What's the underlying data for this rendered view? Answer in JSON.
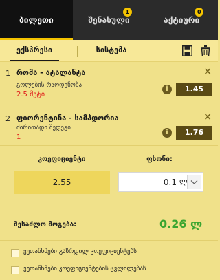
{
  "tabs": [
    {
      "label": "ბილეთი"
    },
    {
      "label": "შენახული",
      "count": "1"
    },
    {
      "label": "აქტიური",
      "count": "0"
    }
  ],
  "subtabs": [
    {
      "label": "ექსპრესი"
    },
    {
      "label": "სისტემა"
    }
  ],
  "icons": {
    "save": "save-icon",
    "trash": "trash-icon",
    "info": "info-icon",
    "close": "close-icon",
    "dropdown": "chevron-down-icon"
  },
  "bets": [
    {
      "number": "1",
      "match": "რომა - ატალანტა",
      "market": "გოლების რაოდენობა",
      "selection": "2.5 მეტი",
      "odds": "1.45",
      "info": "i",
      "close": "×"
    },
    {
      "number": "2",
      "match": "ფიორენტინა - სამპდორია",
      "market": "ძირითადი შედეგი",
      "selection": "1",
      "odds": "1.76",
      "info": "i",
      "close": "×"
    }
  ],
  "coefficient": {
    "label": "კოეფიციენტი",
    "value": "2.55"
  },
  "stake": {
    "label": "ფსონი:",
    "value": "0.1",
    "currency": "ლ"
  },
  "winnings": {
    "label": "შესაძლო მოგება:",
    "value": "0.26 ლ"
  },
  "checkboxes": [
    {
      "label": "ვეთანხმები გაზრდილ კოეფიციენტებს"
    },
    {
      "label": "ვეთანხმები კოეფიციენტების ცვლილებას"
    }
  ],
  "colors": {
    "accent": "#f5c400",
    "win": "#3aa530",
    "selection": "#e01a1a",
    "odds_bg": "#5a4a14",
    "panel_bg": "#f0e18a"
  }
}
